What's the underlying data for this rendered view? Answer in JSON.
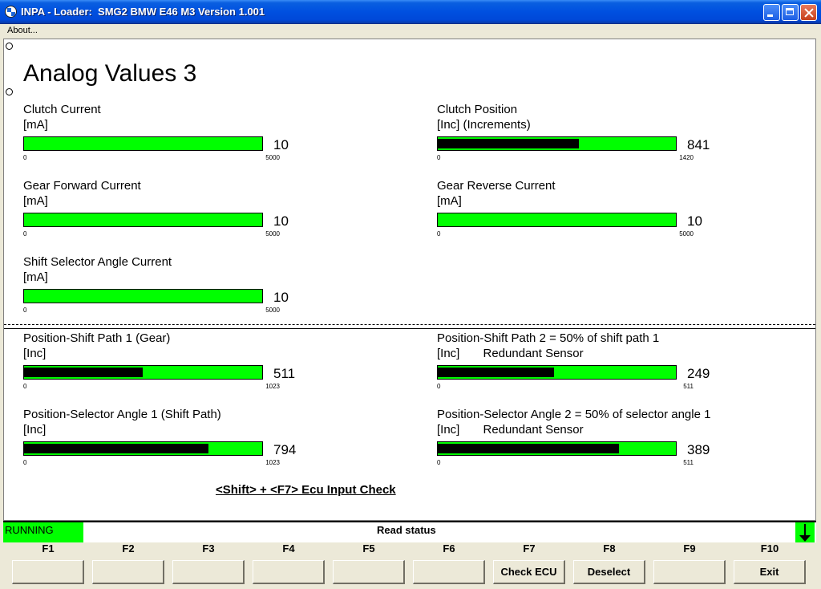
{
  "window": {
    "title": "INPA - Loader:  SMG2 BMW E46 M3 Version 1.001"
  },
  "menu": {
    "about": "About..."
  },
  "page": {
    "title": "Analog Values 3"
  },
  "gauges": [
    {
      "label": "Clutch Current",
      "unit": "[mA]",
      "value": "10",
      "min": "0",
      "max": "5000",
      "level": 0.002
    },
    {
      "label": "Clutch Position",
      "unit": "[Inc] (Increments)",
      "value": "841",
      "min": "0",
      "max": "1420",
      "level": 0.592
    },
    {
      "label": "Gear Forward Current",
      "unit": "[mA]",
      "value": "10",
      "min": "0",
      "max": "5000",
      "level": 0.002
    },
    {
      "label": "Gear Reverse Current",
      "unit": "[mA]",
      "value": "10",
      "min": "0",
      "max": "5000",
      "level": 0.002
    },
    {
      "label": "Shift Selector Angle Current",
      "unit": "[mA]",
      "value": "10",
      "min": "0",
      "max": "5000",
      "level": 0.002
    },
    {
      "label": "Position-Shift Path 1 (Gear)",
      "unit": "[Inc]",
      "value": "511",
      "min": "0",
      "max": "1023",
      "level": 0.4995
    },
    {
      "label": "Position-Shift Path 2 = 50% of shift path 1",
      "unit": "[Inc]       Redundant Sensor",
      "value": "249",
      "min": "0",
      "max": "511",
      "level": 0.487
    },
    {
      "label": "Position-Selector Angle 1 (Shift Path)",
      "unit": "[Inc]",
      "value": "794",
      "min": "0",
      "max": "1023",
      "level": 0.776
    },
    {
      "label": "Position-Selector Angle 2 = 50% of selector angle 1",
      "unit": "[Inc]       Redundant Sensor",
      "value": "389",
      "min": "0",
      "max": "511",
      "level": 0.761
    }
  ],
  "hint": "<Shift> + <F7> Ecu Input Check",
  "status": {
    "state": "RUNNING",
    "message": "Read status"
  },
  "fkeys": [
    {
      "key": "F1",
      "label": ""
    },
    {
      "key": "F2",
      "label": ""
    },
    {
      "key": "F3",
      "label": ""
    },
    {
      "key": "F4",
      "label": ""
    },
    {
      "key": "F5",
      "label": ""
    },
    {
      "key": "F6",
      "label": ""
    },
    {
      "key": "F7",
      "label": "Check ECU"
    },
    {
      "key": "F8",
      "label": "Deselect"
    },
    {
      "key": "F9",
      "label": ""
    },
    {
      "key": "F10",
      "label": "Exit"
    }
  ],
  "colors": {
    "bar": "#00ff00",
    "fill": "#000000",
    "titlebar": "#0050e0"
  }
}
